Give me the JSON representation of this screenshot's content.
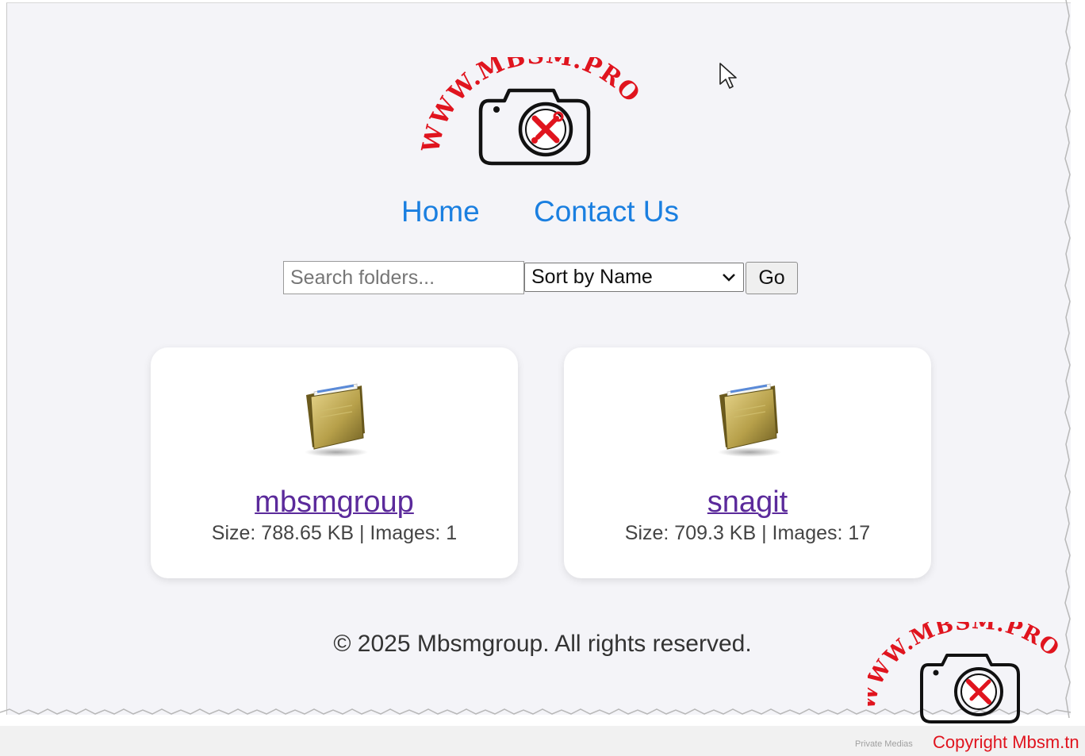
{
  "logo": {
    "arc_text": "WWW.MBSM.PRO",
    "colors": {
      "arc": "#e0141e",
      "camera": "#111111",
      "tools": "#e0141e"
    }
  },
  "nav": {
    "home": "Home",
    "contact": "Contact Us",
    "link_color": "#1a7fe0"
  },
  "search": {
    "placeholder": "Search folders...",
    "sort_value": "Sort by Name",
    "go_label": "Go"
  },
  "folders": [
    {
      "name": "mbsmgroup",
      "meta": "Size: 788.65 KB | Images: 1",
      "icon": "folder-icon"
    },
    {
      "name": "snagit",
      "meta": "Size: 709.3 KB | Images: 17",
      "icon": "folder-icon"
    }
  ],
  "footer": {
    "copyright": "© 2025 Mbsmgroup. All rights reserved."
  },
  "watermark": {
    "small_text": "Private Medias",
    "copyright_text": "Copyright Mbsm.tn",
    "copyright_color": "#e0141e"
  }
}
